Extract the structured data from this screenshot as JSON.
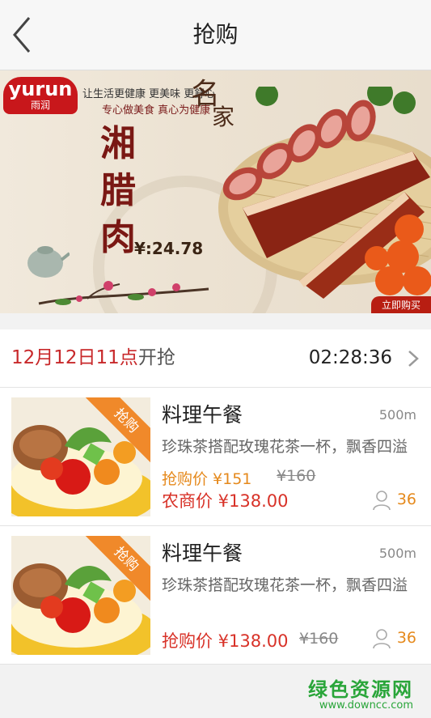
{
  "nav": {
    "title": "抢购",
    "back_icon": "chevron-left-icon"
  },
  "banner": {
    "logo_en": "yurun",
    "logo_zh": "雨润",
    "slogan1": "让生活更健康 更美味 更舒心",
    "slogan2": "专心做美食 真心为健康",
    "brand_big1": "名",
    "brand_big2": "家",
    "title_vertical": "湘腊肉",
    "price": "¥:24.78",
    "buy_button": "立即购买"
  },
  "section": {
    "date_time": "12月12日11点",
    "start_label": "开抢",
    "countdown": "02:28:36",
    "arrow_icon": "chevron-right-icon"
  },
  "products": [
    {
      "ribbon": "抢购",
      "name": "料理午餐",
      "distance": "500m",
      "desc": "珍珠茶搭配玫瑰花茶一杯，飘香四溢",
      "flash_price": "抢购价 ¥151",
      "original_price": "¥160",
      "member_price": "农商价 ¥138.00",
      "count": "36"
    },
    {
      "ribbon": "抢购",
      "name": "料理午餐",
      "distance": "500m",
      "desc": "珍珠茶搭配玫瑰花茶一杯，飘香四溢",
      "flash_price": "抢购价 ¥138.00",
      "original_price": "¥160",
      "count": "36"
    }
  ],
  "watermark": {
    "line1": "绿色资源网",
    "line2": "www.downcc.com"
  },
  "colors": {
    "accent_red": "#d83228",
    "accent_orange": "#e5891c",
    "ribbon": "#f0892a",
    "nav_bg": "#f7f7f7"
  }
}
